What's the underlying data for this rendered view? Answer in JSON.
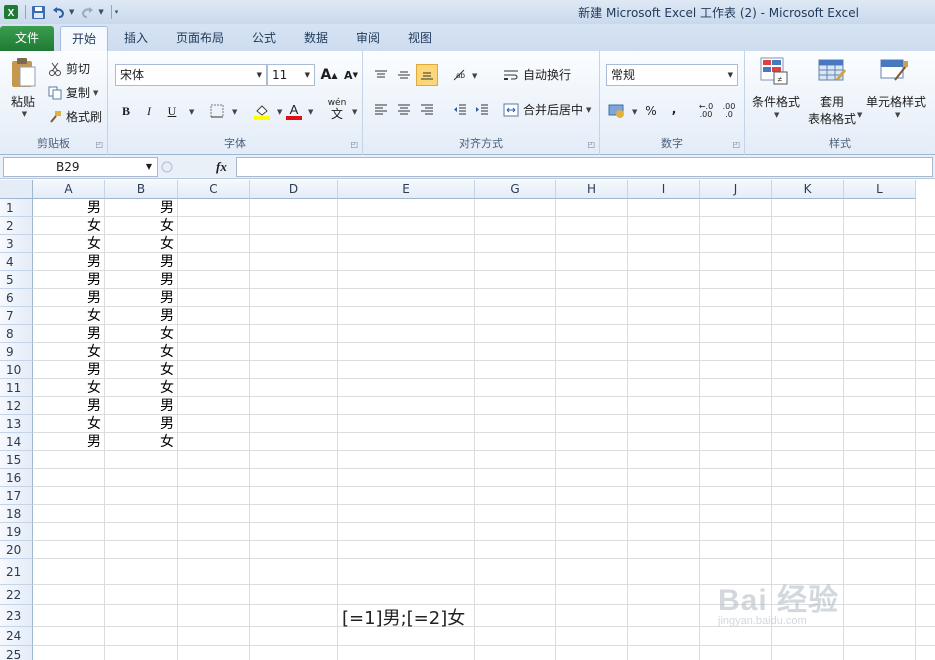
{
  "window": {
    "title": "新建 Microsoft Excel 工作表 (2)  -  Microsoft Excel"
  },
  "tabs": [
    {
      "label": "文件"
    },
    {
      "label": "开始"
    },
    {
      "label": "插入"
    },
    {
      "label": "页面布局"
    },
    {
      "label": "公式"
    },
    {
      "label": "数据"
    },
    {
      "label": "审阅"
    },
    {
      "label": "视图"
    }
  ],
  "ribbon": {
    "clipboard": {
      "group_label": "剪贴板",
      "paste": "粘贴",
      "cut": "剪切",
      "copy": "复制",
      "format_painter": "格式刷"
    },
    "font": {
      "group_label": "字体",
      "font_name": "宋体",
      "font_size": "11",
      "bold": "B",
      "italic": "I",
      "underline": "U",
      "grow": "A",
      "shrink": "A",
      "phonetic": "wén"
    },
    "alignment": {
      "group_label": "对齐方式",
      "wrap_text": "自动换行",
      "merge_center": "合并后居中"
    },
    "number": {
      "group_label": "数字",
      "format": "常规",
      "percent": "%",
      "comma": ",",
      "increase_decimal": ".00",
      "decrease_decimal": ".0"
    },
    "styles": {
      "group_label": "样式",
      "conditional": "条件格式",
      "table_line1": "套用",
      "table_line2": "表格格式",
      "cell_styles": "单元格样式"
    }
  },
  "formula_bar": {
    "name_box": "B29",
    "fx": "fx",
    "value": ""
  },
  "columns": [
    "A",
    "B",
    "C",
    "D",
    "E",
    "G",
    "H",
    "I",
    "J",
    "K",
    "L"
  ],
  "rows": [
    "1",
    "2",
    "3",
    "4",
    "5",
    "6",
    "7",
    "8",
    "9",
    "10",
    "11",
    "12",
    "13",
    "14",
    "15",
    "16",
    "17",
    "18",
    "19",
    "20",
    "21",
    "22",
    "23",
    "24",
    "25"
  ],
  "cells": {
    "A": [
      "男",
      "女",
      "女",
      "男",
      "男",
      "男",
      "女",
      "男",
      "女",
      "男",
      "女",
      "男",
      "女",
      "男"
    ],
    "B": [
      "男",
      "女",
      "女",
      "男",
      "男",
      "男",
      "男",
      "女",
      "女",
      "女",
      "女",
      "男",
      "男",
      "女"
    ]
  },
  "overlay_text": "[=1]男;[=2]女",
  "watermark": {
    "top": "Bai 经验",
    "bottom": "jingyan.baidu.com"
  }
}
